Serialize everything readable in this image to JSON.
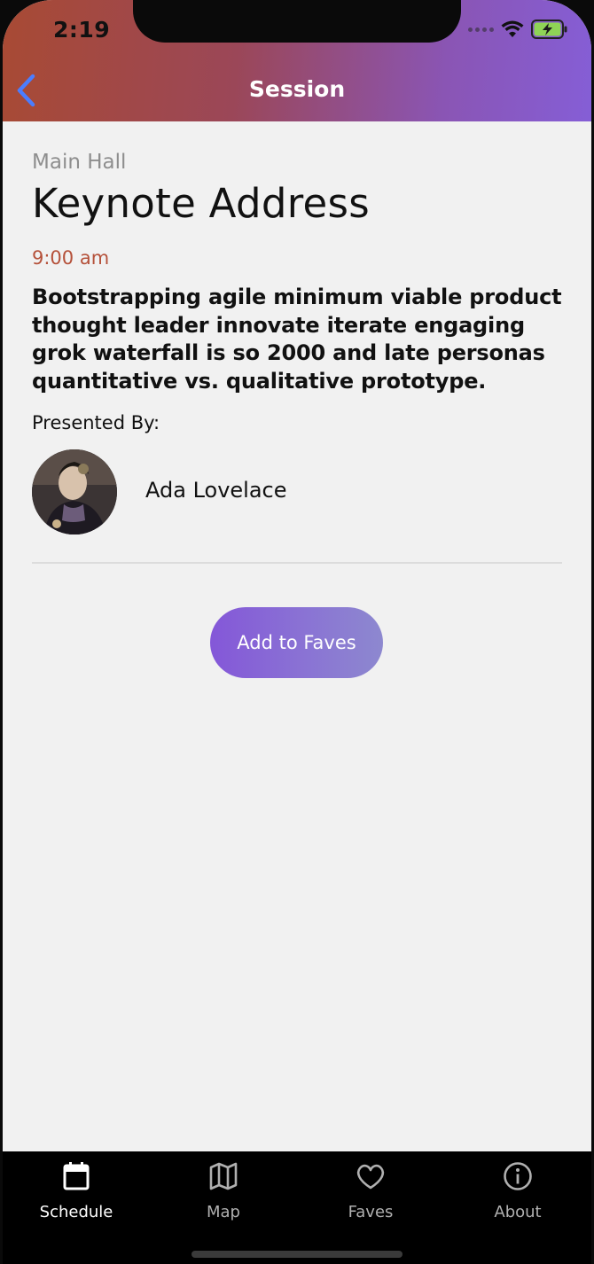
{
  "status_bar": {
    "time": "2:19"
  },
  "header": {
    "title": "Session",
    "gradient_start": "#a84a34",
    "gradient_end": "#855ed6"
  },
  "session": {
    "location": "Main Hall",
    "title": "Keynote Address",
    "time": "9:00 am",
    "description": "Bootstrapping agile minimum viable product thought leader innovate iterate engaging grok waterfall is so 2000 and late personas quantitative vs. qualitative prototype.",
    "presented_by_label": "Presented By:",
    "speaker": {
      "name": "Ada Lovelace",
      "avatar": "speaker-portrait"
    }
  },
  "actions": {
    "add_to_faves_label": "Add to Faves",
    "button_color": "#8457d8"
  },
  "tabbar": {
    "items": [
      {
        "label": "Schedule",
        "icon": "calendar-icon",
        "active": true
      },
      {
        "label": "Map",
        "icon": "map-icon",
        "active": false
      },
      {
        "label": "Faves",
        "icon": "heart-icon",
        "active": false
      },
      {
        "label": "About",
        "icon": "info-icon",
        "active": false
      }
    ]
  },
  "colors": {
    "accent_time": "#b5513a",
    "back_chevron": "#4a7dff"
  }
}
